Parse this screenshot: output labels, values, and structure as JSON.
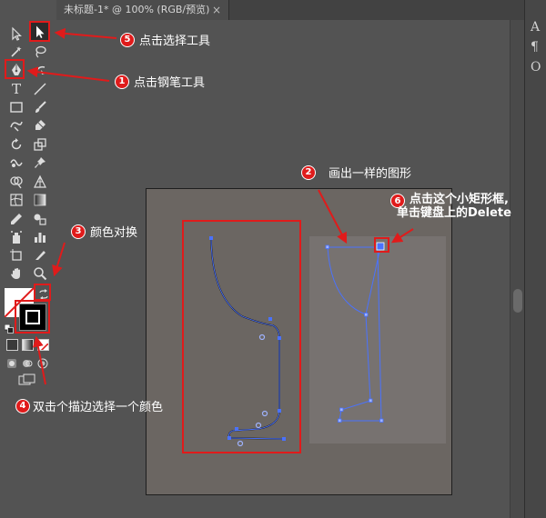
{
  "document_tab": {
    "title": "未标题-1* @ 100% (RGB/预览)",
    "close_glyph": "×"
  },
  "tools": {
    "type_glyph": "T"
  },
  "right_panel": {
    "glyphs": [
      "A",
      "¶",
      "O"
    ]
  },
  "annotations": [
    {
      "num": "5",
      "text": "点击选择工具"
    },
    {
      "num": "1",
      "text": "点击钢笔工具"
    },
    {
      "num": "2",
      "text": "画出一样的图形"
    },
    {
      "num": "6",
      "line1": "点击这个小矩形框,",
      "line2": "单击键盘上的Delete"
    },
    {
      "num": "3",
      "text": "颜色对换"
    },
    {
      "num": "4",
      "text": "双击个描边选择一个颜色"
    }
  ],
  "colors": {
    "annotation_red": "#e01b1b",
    "path_blue": "#4a72ff",
    "artboard": "#6b6662",
    "background": "#535353"
  }
}
